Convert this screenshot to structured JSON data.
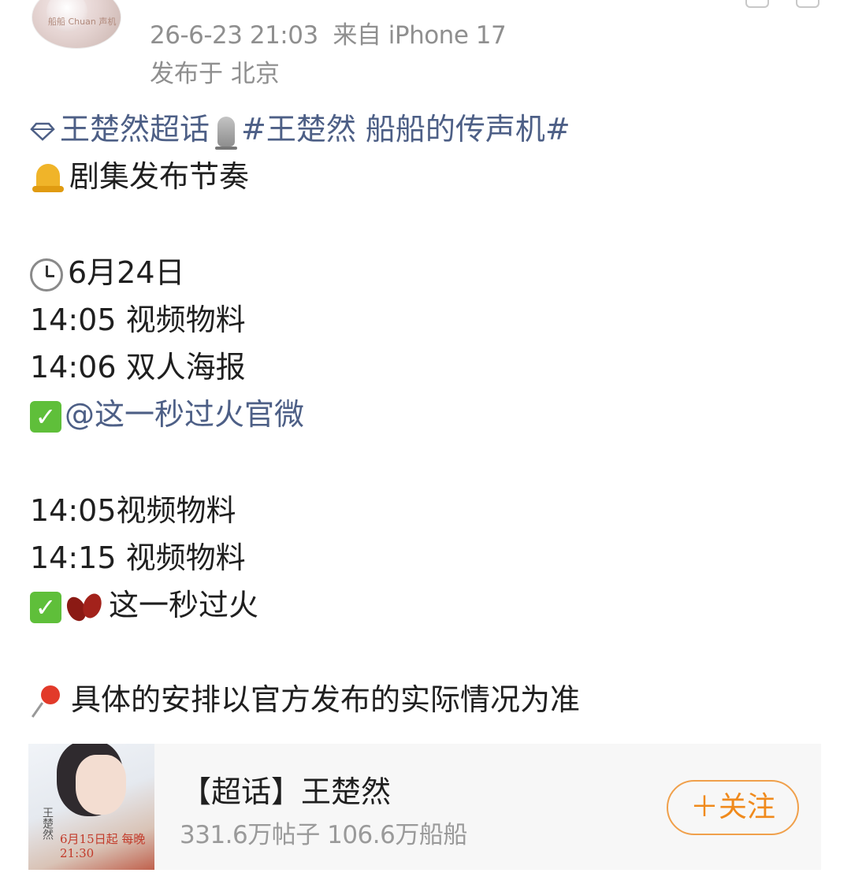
{
  "post": {
    "timestamp": "26-6-23 21:03",
    "source": "来自 iPhone 17",
    "location": "发布于 北京",
    "avatar_caption": "船船 Chuan 声机"
  },
  "content": {
    "supertopic": "王楚然超话",
    "hashtag": "#王楚然 船船的传声机#",
    "heading": "剧集发布节奏",
    "date": "6月24日",
    "group1": [
      "14:05 视频物料",
      "14:06 双人海报"
    ],
    "mention1": "@这一秒过火官微",
    "group2": [
      "14:05视频物料",
      "14:15 视频物料"
    ],
    "mention2": "这一秒过火",
    "note": "具体的安排以官方发布的实际情况为准"
  },
  "card": {
    "title": "【超话】王楚然",
    "stats": "331.6万帖子 106.6万船船",
    "follow_label": "＋关注",
    "poster_name": "王楚然",
    "poster_text": "6月15日起 每晚21:30"
  },
  "icons": [
    "diamond-icon",
    "microphone-icon",
    "bell-icon",
    "clock-icon",
    "check-icon",
    "beans-icon",
    "pushpin-icon"
  ],
  "colors": {
    "link": "#4d5f86",
    "follow": "#f08a1c",
    "meta": "#8f8f8f"
  }
}
